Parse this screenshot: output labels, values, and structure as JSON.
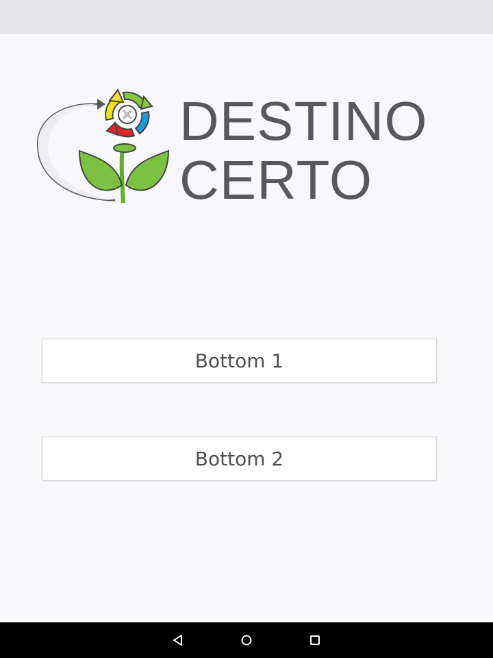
{
  "app": {
    "brand_line_1": "DESTINO",
    "brand_line_2": "CERTO",
    "logo_icon": "recycle-plant-logo"
  },
  "buttons": {
    "first_label": "Bottom 1",
    "second_label": "Bottom 2"
  },
  "navigation": {
    "back_icon": "back-triangle-icon",
    "home_icon": "home-circle-icon",
    "recents_icon": "recents-square-icon"
  },
  "colors": {
    "background": "#f8f8fa",
    "status_bar": "#e5e5e7",
    "brand_text": "#58585a",
    "leaf_green": "#7cc142",
    "arrow_yellow": "#f2e41c",
    "arrow_blue": "#1d9ad6",
    "arrow_red": "#e4252b",
    "arrow_green": "#8cc63f",
    "nav_bar": "#000000"
  }
}
